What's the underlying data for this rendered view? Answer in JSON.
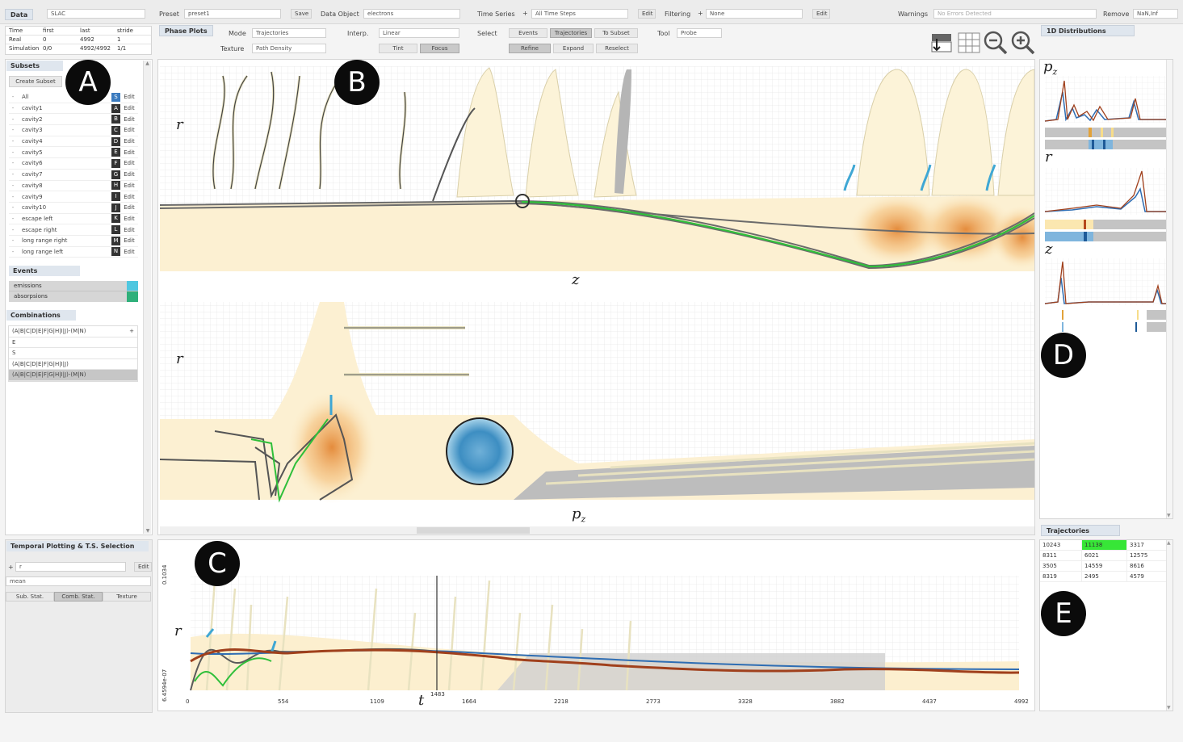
{
  "toolbar": {
    "data_label": "Data",
    "data_value": "SLAC",
    "preset_label": "Preset",
    "preset_value": "preset1",
    "save_label": "Save",
    "data_object_label": "Data Object",
    "data_object_value": "electrons",
    "time_series_label": "Time Series",
    "time_series_value": "All Time Steps",
    "edit_label": "Edit",
    "filtering_label": "Filtering",
    "filtering_value": "None",
    "warnings_label": "Warnings",
    "warnings_value": "No Errors Detected",
    "remove_label": "Remove",
    "remove_value": "NaN,Inf"
  },
  "time_table": {
    "headers": [
      "Time",
      "first",
      "last",
      "stride"
    ],
    "rows": [
      [
        "Real",
        "0",
        "4992",
        "1"
      ],
      [
        "Simulation",
        "0/0",
        "4992/4992",
        "1/1"
      ]
    ]
  },
  "phase_plots": {
    "tab": "Phase Plots",
    "mode_label": "Mode",
    "mode_value": "Trajectories",
    "texture_label": "Texture",
    "texture_value": "Path Density",
    "interp_label": "Interp.",
    "interp_value": "Linear",
    "tint_label": "Tint",
    "focus_label": "Focus",
    "select_label": "Select",
    "events_btn": "Events",
    "trajectories_btn": "Trajectories",
    "to_subset_btn": "To Subset",
    "refine_btn": "Refine",
    "expand_btn": "Expand",
    "reselect_btn": "Reselect",
    "tool_label": "Tool",
    "tool_value": "Probe",
    "top_y": "r",
    "top_x": "z",
    "bottom_y": "r",
    "bottom_x": "p",
    "bottom_x_sub": "z"
  },
  "subsets": {
    "title": "Subsets",
    "create_label": "Create Subset",
    "edit_label": "Edit",
    "items": [
      {
        "name": "All",
        "key": "S",
        "selected": true
      },
      {
        "name": "cavity1",
        "key": "A"
      },
      {
        "name": "cavity2",
        "key": "B"
      },
      {
        "name": "cavity3",
        "key": "C"
      },
      {
        "name": "cavity4",
        "key": "D"
      },
      {
        "name": "cavity5",
        "key": "E"
      },
      {
        "name": "cavity6",
        "key": "F"
      },
      {
        "name": "cavity7",
        "key": "G"
      },
      {
        "name": "cavity8",
        "key": "H"
      },
      {
        "name": "cavity9",
        "key": "I"
      },
      {
        "name": "cavity10",
        "key": "J"
      },
      {
        "name": "escape left",
        "key": "K"
      },
      {
        "name": "escape right",
        "key": "L"
      },
      {
        "name": "long range right",
        "key": "M"
      },
      {
        "name": "long range left",
        "key": "N"
      }
    ]
  },
  "events": {
    "title": "Events",
    "items": [
      {
        "name": "emissions",
        "color": "#4fc7e0"
      },
      {
        "name": "absorpsions",
        "color": "#2fb07a"
      }
    ]
  },
  "combinations": {
    "title": "Combinations",
    "items": [
      {
        "text": "(A|B|C|D|E|F|G|H|I|J)-(M|N)",
        "selected": false
      },
      {
        "text": "E",
        "selected": false
      },
      {
        "text": "S",
        "selected": false
      },
      {
        "text": "(A|B|C|D|E|F|G|H|I|J)",
        "selected": false
      },
      {
        "text": "(A|B|C|D|E|F|G|H|I|J)-(M|N)",
        "selected": true
      }
    ]
  },
  "temporal": {
    "title": "Temporal Plotting & T.S. Selection",
    "variable": "r",
    "edit_label": "Edit",
    "stat_value": "mean",
    "tabs": [
      "Sub. Stat.",
      "Comb. Stat.",
      "Texture"
    ],
    "y_top": "0.1034",
    "y_bottom": "6.4594e-07",
    "y_var": "r",
    "x_var": "t",
    "cursor": "1483",
    "ticks": [
      "0",
      "554",
      "1109",
      "1664",
      "2218",
      "2773",
      "3328",
      "3882",
      "4437",
      "4992"
    ]
  },
  "distributions": {
    "title": "1D Distributions",
    "labels": [
      {
        "var": "p",
        "sub": "z"
      },
      {
        "var": "r",
        "sub": ""
      },
      {
        "var": "z",
        "sub": ""
      }
    ]
  },
  "trajectories": {
    "title": "Trajectories",
    "rows": [
      [
        "10243",
        "11138",
        "3317"
      ],
      [
        "8311",
        "6021",
        "12575"
      ],
      [
        "3505",
        "14559",
        "8616"
      ],
      [
        "8319",
        "2495",
        "4579"
      ]
    ]
  },
  "badges": [
    "A",
    "B",
    "C",
    "D",
    "E"
  ]
}
